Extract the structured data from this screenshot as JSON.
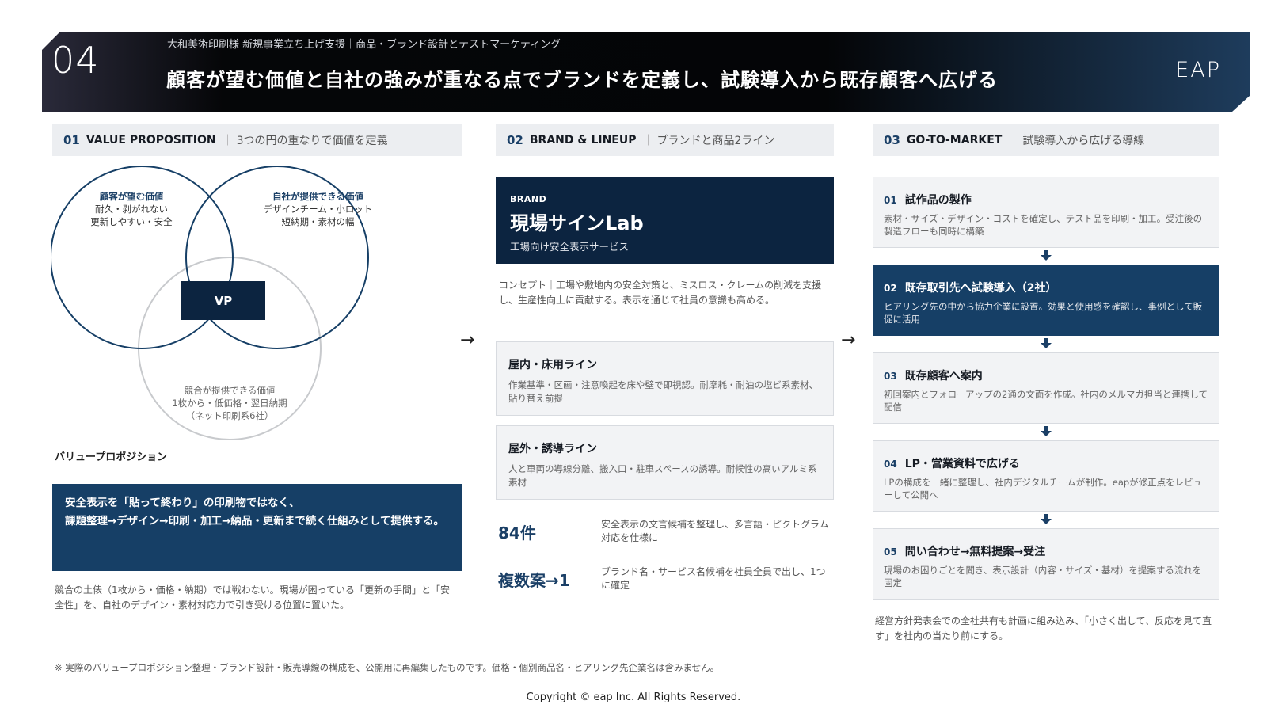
{
  "header": {
    "number": "04",
    "subtitle": "大和美術印刷様 新規事業立ち上げ支援｜商品・ブランド設計とテストマーケティング",
    "title": "顧客が望む価値と自社の強みが重なる点でブランドを定義し、試験導入から既存顧客へ広げる",
    "logo": "EAP"
  },
  "sections": [
    {
      "num": "01",
      "en": "VALUE PROPOSITION",
      "jp": "3つの円の重なりで価値を定義"
    },
    {
      "num": "02",
      "en": "BRAND & LINEUP",
      "jp": "ブランドと商品2ライン"
    },
    {
      "num": "03",
      "en": "GO-TO-MARKET",
      "jp": "試験導入から広げる導線"
    }
  ],
  "separator": "｜",
  "venn": {
    "customer": {
      "head": "顧客が望む価値",
      "l1": "耐久・剥がれない",
      "l2": "更新しやすい・安全"
    },
    "company": {
      "head": "自社が提供できる価値",
      "l1": "デザインチーム・小ロット",
      "l2": "短納期・素材の幅"
    },
    "competitor": {
      "head": "競合が提供できる価値",
      "l1": "1枚から・低価格・翌日納期",
      "l2": "（ネット印刷系6社）"
    },
    "center": "VP"
  },
  "vp": {
    "title": "バリュープロポジション",
    "statement_1": "安全表示を「貼って終わり」の印刷物ではなく、",
    "statement_2": "課題整理→デザイン→印刷・加工→納品・更新まで続く仕組みとして提供する。",
    "note": "競合の土俵（1枚から・価格・納期）では戦わない。現場が困っている「更新の手間」と「安全性」を、自社のデザイン・素材対応力で引き受ける位置に置いた。"
  },
  "brand": {
    "tag": "BRAND",
    "name": "現場サインLab",
    "desc": "工場向け安全表示サービス",
    "concept": "コンセプト｜工場や敷地内の安全対策と、ミスロス・クレームの削減を支援し、生産性向上に貢献する。表示を通じて社員の意識も高める。"
  },
  "lines": [
    {
      "title": "屋内・床用ライン",
      "desc": "作業基準・区画・注意喚起を床や壁で即視認。耐摩耗・耐油の塩ビ系素材、貼り替え前提"
    },
    {
      "title": "屋外・誘導ライン",
      "desc": "人と車両の導線分離、搬入口・駐車スペースの誘導。耐候性の高いアルミ系素材"
    }
  ],
  "stats": [
    {
      "value": "84件",
      "desc": "安全表示の文言候補を整理し、多言語・ピクトグラム対応を仕様に"
    },
    {
      "value": "複数案→1",
      "desc": "ブランド名・サービス名候補を社員全員で出し、1つに確定"
    }
  ],
  "arrow": "→",
  "steps": [
    {
      "num": "01",
      "title": "試作品の製作",
      "desc": "素材・サイズ・デザイン・コストを確定し、テスト品を印刷・加工。受注後の製造フローも同時に構築"
    },
    {
      "num": "02",
      "title": "既存取引先へ試験導入（2社）",
      "desc": "ヒアリング先の中から協力企業に設置。効果と使用感を確認し、事例として販促に活用"
    },
    {
      "num": "03",
      "title": "既存顧客へ案内",
      "desc": "初回案内とフォローアップの2通の文面を作成。社内のメルマガ担当と連携して配信"
    },
    {
      "num": "04",
      "title": "LP・営業資料で広げる",
      "desc": "LPの構成を一緒に整理し、社内デジタルチームが制作。eapが修正点をレビューして公開へ"
    },
    {
      "num": "05",
      "title": "問い合わせ→無料提案→受注",
      "desc": "現場のお困りごとを聞き、表示設計（内容・サイズ・基材）を提案する流れを固定"
    }
  ],
  "gtm_note": "経営方針発表会での全社共有も計画に組み込み、「小さく出して、反応を見て直す」を社内の当たり前にする。",
  "footnote": "※ 実際のバリュープロポジション整理・ブランド設計・販売導線の構成を、公開用に再編集したものです。価格・個別商品名・ヒアリング先企業名は含みません。",
  "copyright": "Copyright © eap Inc. All Rights Reserved.",
  "colors": {
    "navy": "#0c2440",
    "accent": "#163f66",
    "panel": "#eceef1"
  }
}
